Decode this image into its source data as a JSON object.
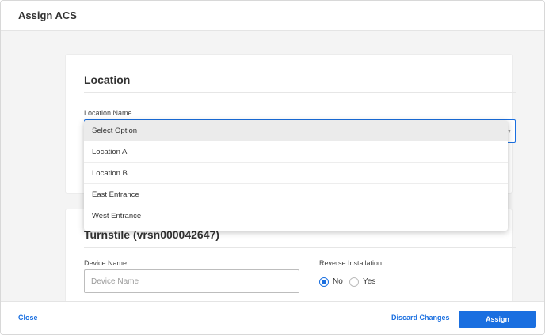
{
  "modal": {
    "title": "Assign ACS"
  },
  "location_card": {
    "title": "Location",
    "location_name_label": "Location Name",
    "dropdown_options": [
      "Select Option",
      "Location A",
      "Location B",
      "East Entrance",
      "West Entrance"
    ],
    "selected_index": 0
  },
  "turnstile_card": {
    "title": "Turnstile (vrsn000042647)",
    "device_name_label": "Device Name",
    "device_name_placeholder": "Device Name",
    "device_name_value": "",
    "reverse_installation_label": "Reverse Installation",
    "radio_no": "No",
    "radio_yes": "Yes",
    "selected_radio": "No"
  },
  "footer": {
    "close_label": "Close",
    "discard_label": "Discard Changes",
    "assign_label": "Assign"
  },
  "colors": {
    "accent": "#1a6fe0",
    "body_background": "#f4f4f4"
  }
}
